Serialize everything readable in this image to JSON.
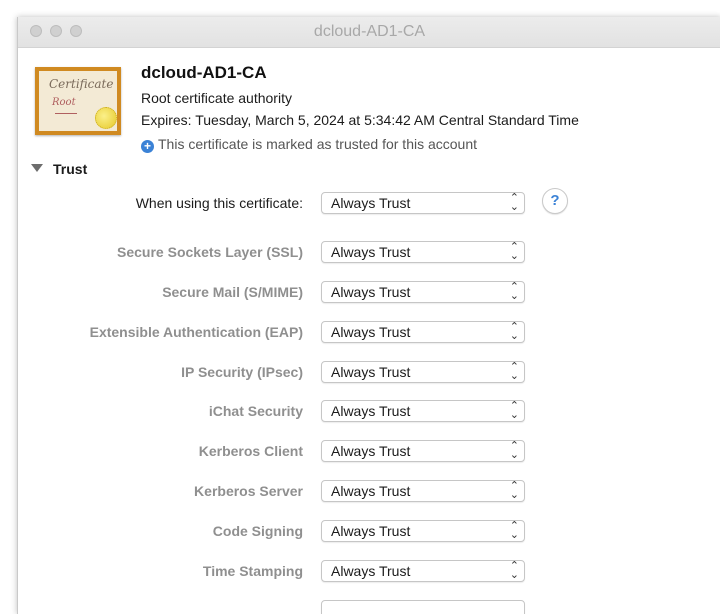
{
  "window": {
    "title": "dcloud-AD1-CA"
  },
  "certificate": {
    "icon_name": "certificate-icon",
    "icon_text_top": "Certificate",
    "icon_text_bottom": "Root",
    "name": "dcloud-AD1-CA",
    "kind": "Root certificate authority",
    "expires": "Expires: Tuesday, March 5, 2024 at 5:34:42 AM Central Standard Time",
    "trust_note": "This certificate is marked as trusted for this account"
  },
  "trust": {
    "section_title": "Trust",
    "when_using": {
      "label": "When using this certificate:",
      "value": "Always Trust"
    },
    "help_label": "?",
    "rows": [
      {
        "label": "Secure Sockets Layer (SSL)",
        "value": "Always Trust"
      },
      {
        "label": "Secure Mail (S/MIME)",
        "value": "Always Trust"
      },
      {
        "label": "Extensible Authentication (EAP)",
        "value": "Always Trust"
      },
      {
        "label": "IP Security (IPsec)",
        "value": "Always Trust"
      },
      {
        "label": "iChat Security",
        "value": "Always Trust"
      },
      {
        "label": "Kerberos Client",
        "value": "Always Trust"
      },
      {
        "label": "Kerberos Server",
        "value": "Always Trust"
      },
      {
        "label": "Code Signing",
        "value": "Always Trust"
      },
      {
        "label": "Time Stamping",
        "value": "Always Trust"
      }
    ]
  },
  "colors": {
    "accent": "#3b82d6",
    "cert_border": "#d08a21"
  }
}
